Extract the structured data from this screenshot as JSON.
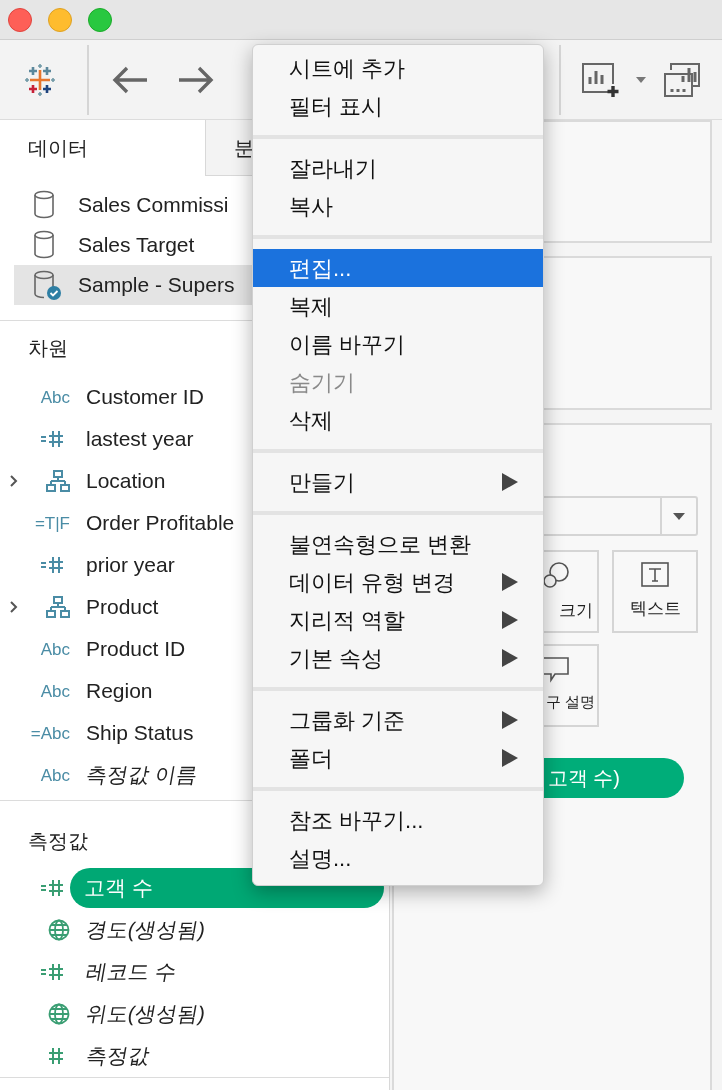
{
  "data_pane": {
    "tabs": [
      {
        "label": "데이터",
        "selected": true
      },
      {
        "label": "분",
        "selected": false
      }
    ],
    "data_sources": [
      {
        "name": "Sales Commissi",
        "selected": false,
        "in_use": false
      },
      {
        "name": "Sales Target",
        "selected": false,
        "in_use": false
      },
      {
        "name": "Sample - Supers",
        "selected": true,
        "in_use": true
      }
    ],
    "dimensions": {
      "title": "차원",
      "fields": [
        {
          "name": "Customer ID",
          "type_label": "Abc",
          "expandable": false,
          "italic": false,
          "selected": false
        },
        {
          "name": "lastest year",
          "kind": "calc_number",
          "expandable": false,
          "italic": false,
          "selected": false
        },
        {
          "name": "Location",
          "kind": "hierarchy",
          "expandable": true,
          "italic": false,
          "selected": false
        },
        {
          "name": "Order Profitable",
          "type_label": "=T|F",
          "expandable": false,
          "italic": false,
          "selected": false
        },
        {
          "name": "prior year",
          "kind": "calc_number",
          "expandable": false,
          "italic": false,
          "selected": false
        },
        {
          "name": "Product",
          "kind": "hierarchy",
          "expandable": true,
          "italic": false,
          "selected": false
        },
        {
          "name": "Product ID",
          "type_label": "Abc",
          "expandable": false,
          "italic": false,
          "selected": false
        },
        {
          "name": "Region",
          "type_label": "Abc",
          "expandable": false,
          "italic": false,
          "selected": false
        },
        {
          "name": "Ship Status",
          "type_label": "=Abc",
          "expandable": false,
          "italic": false,
          "selected": false
        },
        {
          "name": "측정값 이름",
          "type_label": "Abc",
          "expandable": false,
          "italic": true,
          "selected": false
        }
      ]
    },
    "measures": {
      "title": "측정값",
      "fields": [
        {
          "name": "고객 수",
          "kind": "calc_number",
          "expandable": false,
          "italic": false,
          "selected": true
        },
        {
          "name": "경도(생성됨)",
          "kind": "globe",
          "expandable": false,
          "italic": true,
          "selected": false
        },
        {
          "name": "레코드 수",
          "kind": "calc_number",
          "expandable": false,
          "italic": true,
          "selected": false
        },
        {
          "name": "위도(생성됨)",
          "kind": "globe",
          "expandable": false,
          "italic": true,
          "selected": false
        },
        {
          "name": "측정값",
          "kind": "number",
          "expandable": false,
          "italic": true,
          "selected": false
        }
      ]
    }
  },
  "marks_card": {
    "buttons": [
      {
        "kind": "size",
        "label": "크기"
      },
      {
        "kind": "text",
        "label": "텍스트"
      },
      {
        "kind": "tooltip",
        "label": "구 설명"
      }
    ],
    "pill": "고객 수)"
  },
  "context_menu": {
    "groups": [
      {
        "items": [
          {
            "label": "시트에 추가",
            "selected": false,
            "disabled": false,
            "submenu": false
          },
          {
            "label": "필터 표시",
            "selected": false,
            "disabled": false,
            "submenu": false
          }
        ]
      },
      {
        "items": [
          {
            "label": "잘라내기",
            "selected": false,
            "disabled": false,
            "submenu": false
          },
          {
            "label": "복사",
            "selected": false,
            "disabled": false,
            "submenu": false
          }
        ]
      },
      {
        "items": [
          {
            "label": "편집...",
            "selected": true,
            "disabled": false,
            "submenu": false
          },
          {
            "label": "복제",
            "selected": false,
            "disabled": false,
            "submenu": false
          },
          {
            "label": "이름 바꾸기",
            "selected": false,
            "disabled": false,
            "submenu": false
          },
          {
            "label": "숨기기",
            "selected": false,
            "disabled": true,
            "submenu": false
          },
          {
            "label": "삭제",
            "selected": false,
            "disabled": false,
            "submenu": false
          }
        ]
      },
      {
        "items": [
          {
            "label": "만들기",
            "selected": false,
            "disabled": false,
            "submenu": true
          }
        ]
      },
      {
        "items": [
          {
            "label": "불연속형으로 변환",
            "selected": false,
            "disabled": false,
            "submenu": false
          },
          {
            "label": "데이터 유형 변경",
            "selected": false,
            "disabled": false,
            "submenu": true
          },
          {
            "label": "지리적 역할",
            "selected": false,
            "disabled": false,
            "submenu": true
          },
          {
            "label": "기본 속성",
            "selected": false,
            "disabled": false,
            "submenu": true
          }
        ]
      },
      {
        "items": [
          {
            "label": "그룹화 기준",
            "selected": false,
            "disabled": false,
            "submenu": true
          },
          {
            "label": "폴더",
            "selected": false,
            "disabled": false,
            "submenu": true
          }
        ]
      },
      {
        "items": [
          {
            "label": "참조 바꾸기...",
            "selected": false,
            "disabled": false,
            "submenu": false
          },
          {
            "label": "설명...",
            "selected": false,
            "disabled": false,
            "submenu": false
          }
        ]
      }
    ]
  }
}
